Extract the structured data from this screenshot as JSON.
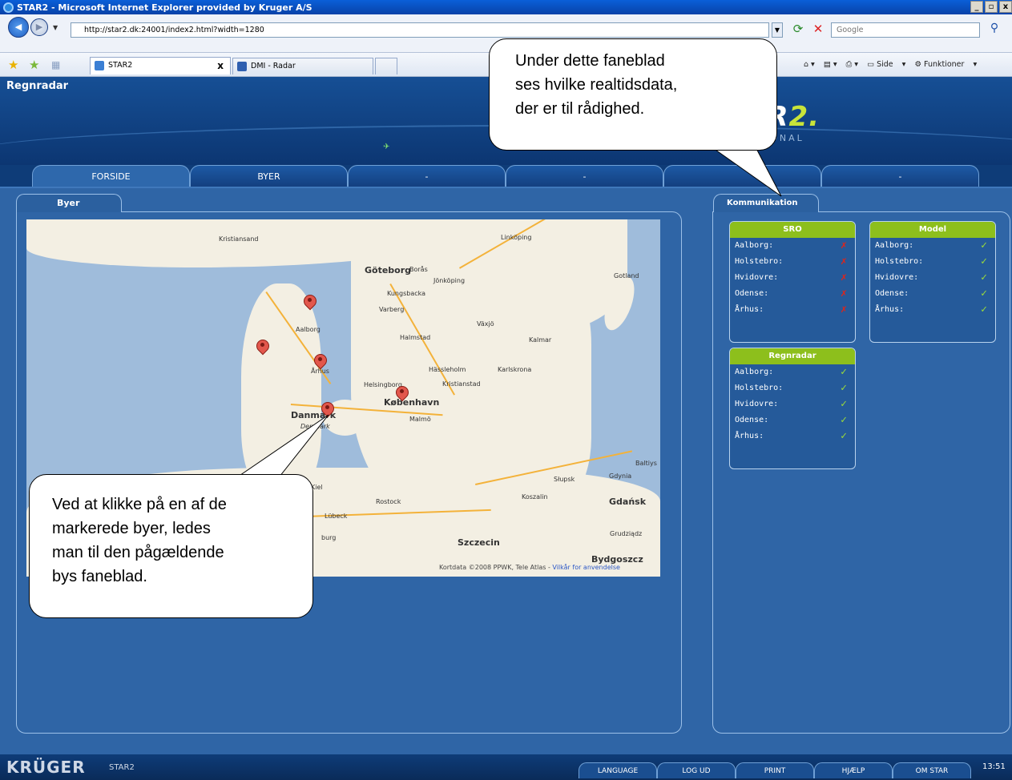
{
  "window": {
    "title": "STAR2 - Microsoft Internet Explorer provided by Kruger A/S",
    "controls": [
      "_",
      "▫",
      "x"
    ]
  },
  "browser": {
    "url": "http://star2.dk:24001/index2.html?width=1280",
    "search_placeholder": "Google",
    "tabs": [
      {
        "label": "STAR2",
        "close": "x"
      },
      {
        "label": "DMI - Radar"
      }
    ],
    "command_bar": [
      "Side",
      "Funktioner"
    ]
  },
  "app": {
    "title": "Regnradar",
    "logo_main": "AR",
    "logo_accent": "2.",
    "logo_sub": "SSIONAL",
    "tabs": [
      "FORSIDE",
      "BYER",
      "-",
      "-",
      "",
      "-"
    ],
    "panel_left_tab": "Byer",
    "panel_right_tab": "Kommunikation"
  },
  "map": {
    "cities": [
      "Kristiansand",
      "Linköping",
      "Göteborg",
      "Borås",
      "Jönköping",
      "Gotland",
      "Kungsbacka",
      "Varberg",
      "Växjö",
      "Aalborg",
      "Halmstad",
      "Kalmar",
      "Hässleholm",
      "Karlskrona",
      "Århus",
      "Helsingborg",
      "Kristianstad",
      "København",
      "Malmö",
      "Danmark",
      "Denmark",
      "Kiel",
      "Rostock",
      "Koszalin",
      "Słupsk",
      "Gdynia",
      "Gdańsk",
      "Lübeck",
      "Szczecin",
      "Grudziądz",
      "Bydgoszcz",
      "Baltiys",
      "Baltiysk",
      "burg"
    ],
    "copyright": "Kortdata ©2008 PPWK, Tele Atlas -",
    "terms_link": "Vilkår for anvendelse"
  },
  "status": {
    "sro": {
      "title": "SRO",
      "rows": [
        {
          "city": "Aalborg:",
          "state": "✗"
        },
        {
          "city": "Holstebro:",
          "state": "✗"
        },
        {
          "city": "Hvidovre:",
          "state": "✗"
        },
        {
          "city": "Odense:",
          "state": "✗"
        },
        {
          "city": "Århus:",
          "state": "✗"
        }
      ]
    },
    "model": {
      "title": "Model",
      "rows": [
        {
          "city": "Aalborg:",
          "state": "✓"
        },
        {
          "city": "Holstebro:",
          "state": "✓"
        },
        {
          "city": "Hvidovre:",
          "state": "✓"
        },
        {
          "city": "Odense:",
          "state": "✓"
        },
        {
          "city": "Århus:",
          "state": "✓"
        }
      ]
    },
    "regnradar": {
      "title": "Regnradar",
      "rows": [
        {
          "city": "Aalborg:",
          "state": "✓"
        },
        {
          "city": "Holstebro:",
          "state": "✓"
        },
        {
          "city": "Hvidovre:",
          "state": "✓"
        },
        {
          "city": "Odense:",
          "state": "✓"
        },
        {
          "city": "Århus:",
          "state": "✓"
        }
      ]
    }
  },
  "footer": {
    "logo": "KRÜGER",
    "app_name": "STAR2",
    "buttons": [
      "LANGUAGE",
      "LOG UD",
      "PRINT",
      "HJÆLP",
      "OM STAR"
    ],
    "clock": "13:51"
  },
  "callouts": {
    "top": [
      "Under dette faneblad",
      "ses hvilke realtidsdata,",
      "der er til rådighed."
    ],
    "bottom": [
      "Ved at klikke på en af de",
      "markerede byer, ledes",
      "man til den pågældende",
      "bys faneblad."
    ]
  },
  "colors": {
    "app_bg": "#0e3c78",
    "panel_bg": "#2f65a6",
    "status_header": "#8dbf1c",
    "ok": "#9cdc3a",
    "bad": "#e0241a",
    "marker": "#e2574c"
  }
}
